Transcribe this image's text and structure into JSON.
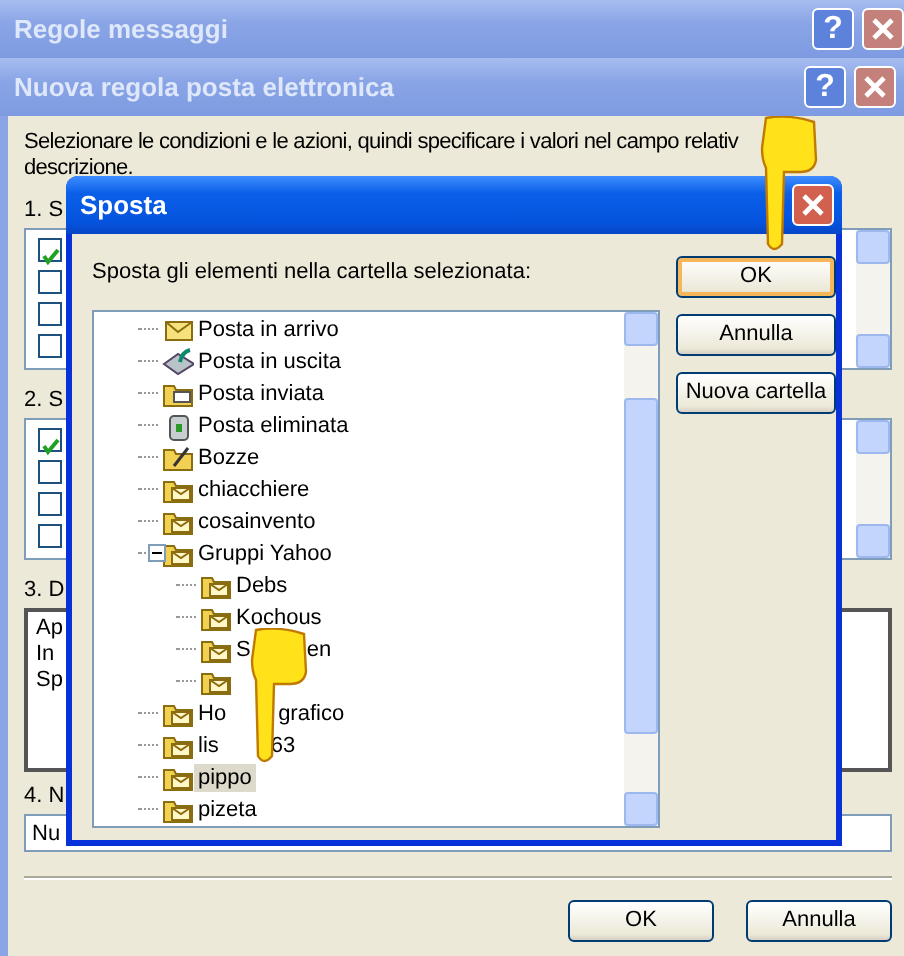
{
  "back_window": {
    "title": "Regole messaggi",
    "help_button": "?"
  },
  "rule_window": {
    "title": "Nuova regola posta elettronica",
    "help_button": "?",
    "instructions": [
      "Selezionare le condizioni e le azioni, quindi specificare i valori nel campo relativ",
      "descrizione."
    ],
    "sections": [
      {
        "kind": "checklist",
        "heading": "1. S",
        "items": [
          {
            "checked": true
          },
          {
            "checked": false
          },
          {
            "checked": false
          },
          {
            "checked": false
          }
        ]
      },
      {
        "kind": "checklist",
        "heading": "2. S",
        "items": [
          {
            "checked": true
          },
          {
            "checked": false
          },
          {
            "checked": false
          },
          {
            "checked": false
          }
        ]
      },
      {
        "kind": "description",
        "heading": "3. D",
        "lines": [
          "Ap",
          "In",
          "Sp"
        ]
      },
      {
        "kind": "input",
        "heading": "4. N",
        "value": "Nu"
      }
    ],
    "buttons": [
      "OK",
      "Annulla"
    ]
  },
  "move_dialog": {
    "title": "Sposta",
    "prompt": "Sposta gli elementi nella cartella selezionata:",
    "folders": [
      {
        "kind": "inbox",
        "parts": [
          "Posta in arrivo"
        ],
        "selected": false
      },
      {
        "kind": "outbox",
        "parts": [
          "Posta in uscita"
        ],
        "selected": false
      },
      {
        "kind": "sent",
        "parts": [
          "Posta inviata"
        ],
        "selected": false
      },
      {
        "kind": "deleted",
        "parts": [
          "Posta eliminata"
        ],
        "selected": false
      },
      {
        "kind": "drafts",
        "parts": [
          "Bozze"
        ],
        "selected": false
      },
      {
        "kind": "folder",
        "parts": [
          "chiacchiere"
        ],
        "selected": false
      },
      {
        "kind": "folder",
        "parts": [
          "cosainvento"
        ],
        "selected": false
      },
      {
        "kind": "folder",
        "parts": [
          "Gruppi Yahoo"
        ],
        "selected": false,
        "expanded": true,
        "children": [
          {
            "kind": "folder",
            "parts": [
              "Debs"
            ],
            "selected": false
          },
          {
            "kind": "folder",
            "parts": [
              "Kochous"
            ],
            "selected": false
          },
          {
            "kind": "folder",
            "parts": [
              "S",
              "en"
            ],
            "selected": false
          },
          {
            "kind": "folder",
            "selected": false
          }
        ]
      },
      {
        "kind": "folder",
        "parts": [
          "Ho",
          "grafico"
        ],
        "selected": false
      },
      {
        "kind": "folder",
        "parts": [
          "lis",
          "63"
        ],
        "selected": false
      },
      {
        "kind": "folder",
        "parts": [
          "pippo"
        ],
        "selected": true
      },
      {
        "kind": "folder",
        "parts": [
          "pizeta"
        ],
        "selected": false
      }
    ],
    "buttons": [
      {
        "label": "OK",
        "default": true
      },
      {
        "label": "Annulla",
        "default": false
      },
      {
        "label": "Nuova cartella",
        "default": false
      }
    ]
  }
}
